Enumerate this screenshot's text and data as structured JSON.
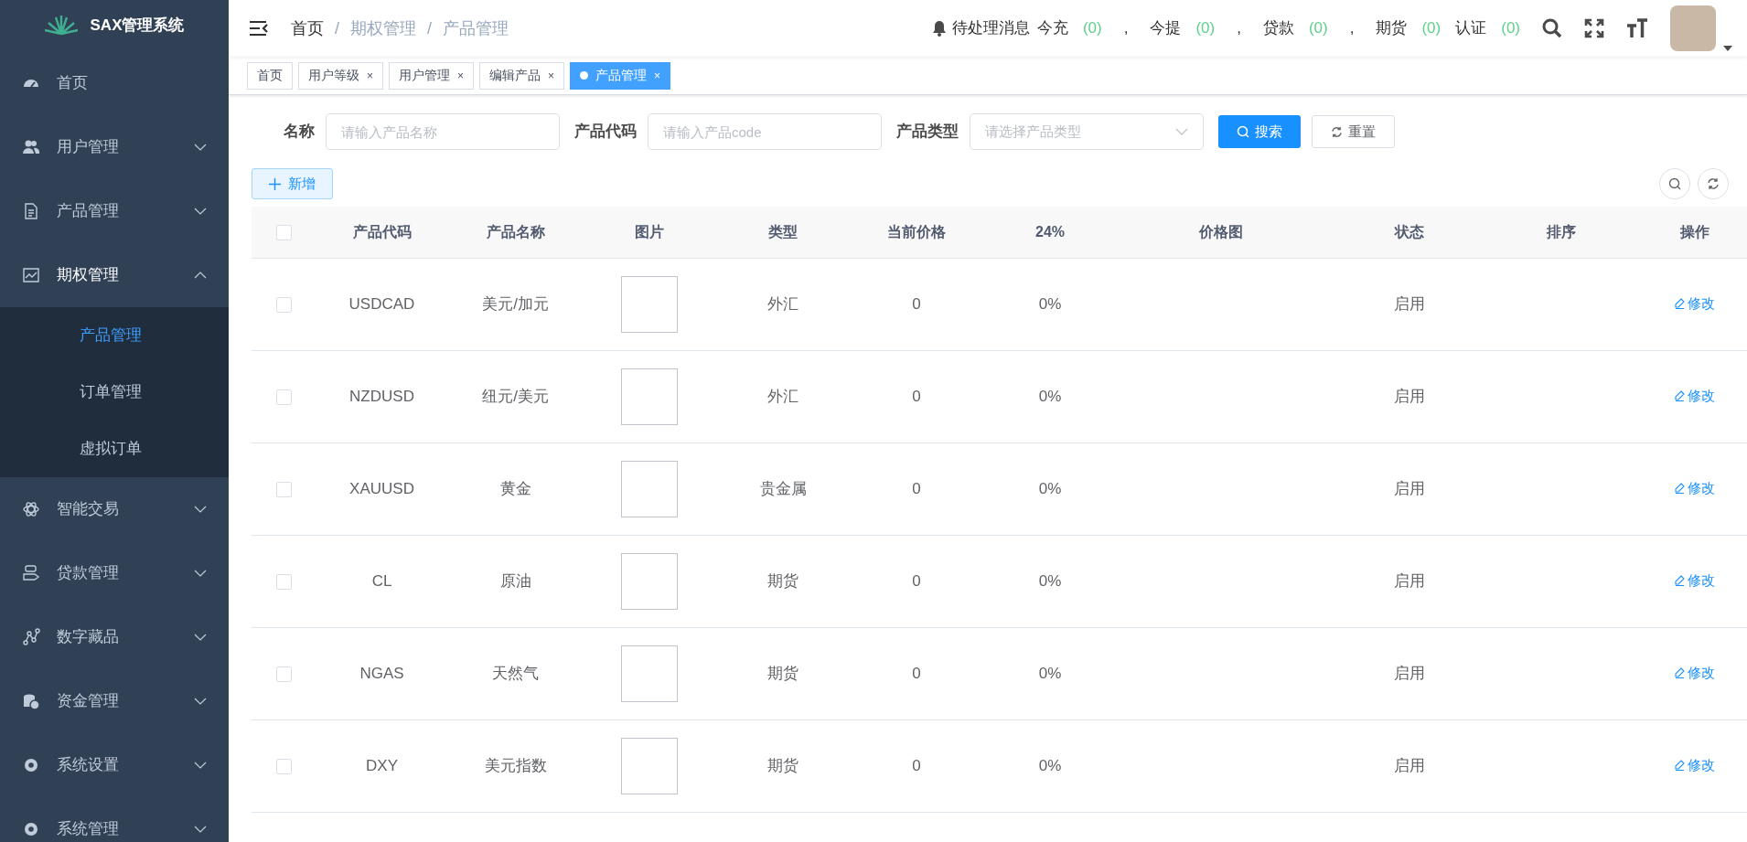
{
  "logo": {
    "title": "SAX管理系统"
  },
  "sidebar": {
    "items": [
      {
        "label": "首页"
      },
      {
        "label": "用户管理",
        "expanded": false
      },
      {
        "label": "产品管理",
        "expanded": false
      },
      {
        "label": "期权管理",
        "expanded": true,
        "children": [
          {
            "label": "产品管理",
            "selected": true
          },
          {
            "label": "订单管理",
            "selected": false
          },
          {
            "label": "虚拟订单",
            "selected": false
          }
        ]
      },
      {
        "label": "智能交易",
        "expanded": false
      },
      {
        "label": "贷款管理",
        "expanded": false
      },
      {
        "label": "数字藏品",
        "expanded": false
      },
      {
        "label": "资金管理",
        "expanded": false
      },
      {
        "label": "系统设置",
        "expanded": false
      },
      {
        "label": "系统管理",
        "expanded": false
      }
    ]
  },
  "breadcrumb": [
    "首页",
    "期权管理",
    "产品管理"
  ],
  "breadcrumb_separator": "/",
  "notifications": {
    "label": "待处理消息",
    "items": [
      {
        "label": "今充",
        "count": "(0)"
      },
      {
        "label": "今提",
        "count": "(0)"
      },
      {
        "label": "贷款",
        "count": "(0)"
      },
      {
        "label": "期货",
        "count": "(0)"
      },
      {
        "label": "认证",
        "count": "(0)"
      }
    ],
    "separator": ","
  },
  "tabs": [
    {
      "label": "首页",
      "selected": false,
      "closable": false
    },
    {
      "label": "用户等级",
      "selected": false,
      "closable": true
    },
    {
      "label": "用户管理",
      "selected": false,
      "closable": true
    },
    {
      "label": "编辑产品",
      "selected": false,
      "closable": true
    },
    {
      "label": "产品管理",
      "selected": true,
      "closable": true
    }
  ],
  "close_glyph": "×",
  "filters": [
    {
      "label": "名称",
      "kind": "input",
      "placeholder": "请输入产品名称"
    },
    {
      "label": "产品代码",
      "kind": "input",
      "placeholder": "请输入产品code"
    },
    {
      "label": "产品类型",
      "kind": "select",
      "placeholder": "请选择产品类型"
    }
  ],
  "search_button": "搜索",
  "reset_button": "重置",
  "add_button": "新增",
  "table": {
    "all_checked": false,
    "columns": [
      "产品代码",
      "产品名称",
      "图片",
      "类型",
      "当前价格",
      "24%",
      "价格图",
      "状态",
      "排序",
      "操作"
    ],
    "rows": [
      {
        "checked": false,
        "code": "USDCAD",
        "name": "美元/加元",
        "type": "外汇",
        "price": "0",
        "change": "0%",
        "status": "启用",
        "action": "修改"
      },
      {
        "checked": false,
        "code": "NZDUSD",
        "name": "纽元/美元",
        "type": "外汇",
        "price": "0",
        "change": "0%",
        "status": "启用",
        "action": "修改"
      },
      {
        "checked": false,
        "code": "XAUUSD",
        "name": "黄金",
        "type": "贵金属",
        "price": "0",
        "change": "0%",
        "status": "启用",
        "action": "修改"
      },
      {
        "checked": false,
        "code": "CL",
        "name": "原油",
        "type": "期货",
        "price": "0",
        "change": "0%",
        "status": "启用",
        "action": "修改"
      },
      {
        "checked": false,
        "code": "NGAS",
        "name": "天然气",
        "type": "期货",
        "price": "0",
        "change": "0%",
        "status": "启用",
        "action": "修改"
      },
      {
        "checked": false,
        "code": "DXY",
        "name": "美元指数",
        "type": "期货",
        "price": "0",
        "change": "0%",
        "status": "启用",
        "action": "修改"
      }
    ]
  }
}
